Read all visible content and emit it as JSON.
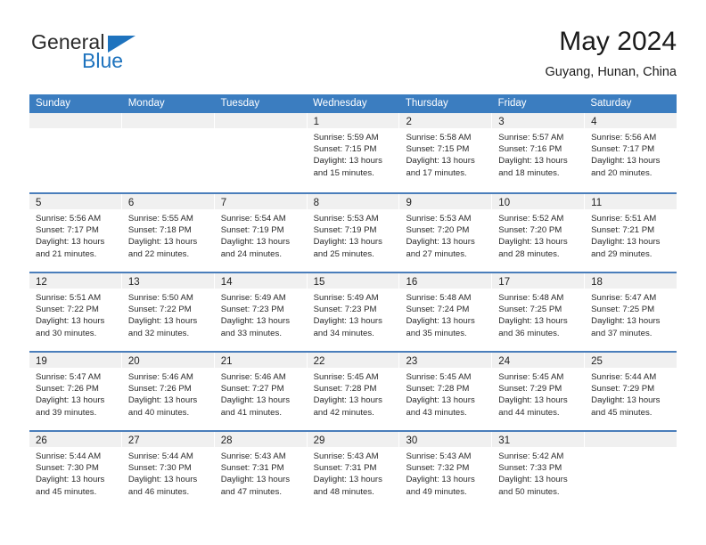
{
  "brand": {
    "name_top": "General",
    "name_bottom": "Blue",
    "triangle_color": "#1e73be"
  },
  "header": {
    "title": "May 2024",
    "subtitle": "Guyang, Hunan, China"
  },
  "theme": {
    "header_row_bg": "#3b7dc0",
    "week_separator": "#4a7ebb",
    "daynum_band_bg": "#f0f0f0",
    "text": "#222222"
  },
  "weekdays": [
    "Sunday",
    "Monday",
    "Tuesday",
    "Wednesday",
    "Thursday",
    "Friday",
    "Saturday"
  ],
  "weeks": [
    [
      {
        "day": "",
        "sunrise": "",
        "sunset": "",
        "daylight_1": "",
        "daylight_2": ""
      },
      {
        "day": "",
        "sunrise": "",
        "sunset": "",
        "daylight_1": "",
        "daylight_2": ""
      },
      {
        "day": "",
        "sunrise": "",
        "sunset": "",
        "daylight_1": "",
        "daylight_2": ""
      },
      {
        "day": "1",
        "sunrise": "Sunrise: 5:59 AM",
        "sunset": "Sunset: 7:15 PM",
        "daylight_1": "Daylight: 13 hours",
        "daylight_2": "and 15 minutes."
      },
      {
        "day": "2",
        "sunrise": "Sunrise: 5:58 AM",
        "sunset": "Sunset: 7:15 PM",
        "daylight_1": "Daylight: 13 hours",
        "daylight_2": "and 17 minutes."
      },
      {
        "day": "3",
        "sunrise": "Sunrise: 5:57 AM",
        "sunset": "Sunset: 7:16 PM",
        "daylight_1": "Daylight: 13 hours",
        "daylight_2": "and 18 minutes."
      },
      {
        "day": "4",
        "sunrise": "Sunrise: 5:56 AM",
        "sunset": "Sunset: 7:17 PM",
        "daylight_1": "Daylight: 13 hours",
        "daylight_2": "and 20 minutes."
      }
    ],
    [
      {
        "day": "5",
        "sunrise": "Sunrise: 5:56 AM",
        "sunset": "Sunset: 7:17 PM",
        "daylight_1": "Daylight: 13 hours",
        "daylight_2": "and 21 minutes."
      },
      {
        "day": "6",
        "sunrise": "Sunrise: 5:55 AM",
        "sunset": "Sunset: 7:18 PM",
        "daylight_1": "Daylight: 13 hours",
        "daylight_2": "and 22 minutes."
      },
      {
        "day": "7",
        "sunrise": "Sunrise: 5:54 AM",
        "sunset": "Sunset: 7:19 PM",
        "daylight_1": "Daylight: 13 hours",
        "daylight_2": "and 24 minutes."
      },
      {
        "day": "8",
        "sunrise": "Sunrise: 5:53 AM",
        "sunset": "Sunset: 7:19 PM",
        "daylight_1": "Daylight: 13 hours",
        "daylight_2": "and 25 minutes."
      },
      {
        "day": "9",
        "sunrise": "Sunrise: 5:53 AM",
        "sunset": "Sunset: 7:20 PM",
        "daylight_1": "Daylight: 13 hours",
        "daylight_2": "and 27 minutes."
      },
      {
        "day": "10",
        "sunrise": "Sunrise: 5:52 AM",
        "sunset": "Sunset: 7:20 PM",
        "daylight_1": "Daylight: 13 hours",
        "daylight_2": "and 28 minutes."
      },
      {
        "day": "11",
        "sunrise": "Sunrise: 5:51 AM",
        "sunset": "Sunset: 7:21 PM",
        "daylight_1": "Daylight: 13 hours",
        "daylight_2": "and 29 minutes."
      }
    ],
    [
      {
        "day": "12",
        "sunrise": "Sunrise: 5:51 AM",
        "sunset": "Sunset: 7:22 PM",
        "daylight_1": "Daylight: 13 hours",
        "daylight_2": "and 30 minutes."
      },
      {
        "day": "13",
        "sunrise": "Sunrise: 5:50 AM",
        "sunset": "Sunset: 7:22 PM",
        "daylight_1": "Daylight: 13 hours",
        "daylight_2": "and 32 minutes."
      },
      {
        "day": "14",
        "sunrise": "Sunrise: 5:49 AM",
        "sunset": "Sunset: 7:23 PM",
        "daylight_1": "Daylight: 13 hours",
        "daylight_2": "and 33 minutes."
      },
      {
        "day": "15",
        "sunrise": "Sunrise: 5:49 AM",
        "sunset": "Sunset: 7:23 PM",
        "daylight_1": "Daylight: 13 hours",
        "daylight_2": "and 34 minutes."
      },
      {
        "day": "16",
        "sunrise": "Sunrise: 5:48 AM",
        "sunset": "Sunset: 7:24 PM",
        "daylight_1": "Daylight: 13 hours",
        "daylight_2": "and 35 minutes."
      },
      {
        "day": "17",
        "sunrise": "Sunrise: 5:48 AM",
        "sunset": "Sunset: 7:25 PM",
        "daylight_1": "Daylight: 13 hours",
        "daylight_2": "and 36 minutes."
      },
      {
        "day": "18",
        "sunrise": "Sunrise: 5:47 AM",
        "sunset": "Sunset: 7:25 PM",
        "daylight_1": "Daylight: 13 hours",
        "daylight_2": "and 37 minutes."
      }
    ],
    [
      {
        "day": "19",
        "sunrise": "Sunrise: 5:47 AM",
        "sunset": "Sunset: 7:26 PM",
        "daylight_1": "Daylight: 13 hours",
        "daylight_2": "and 39 minutes."
      },
      {
        "day": "20",
        "sunrise": "Sunrise: 5:46 AM",
        "sunset": "Sunset: 7:26 PM",
        "daylight_1": "Daylight: 13 hours",
        "daylight_2": "and 40 minutes."
      },
      {
        "day": "21",
        "sunrise": "Sunrise: 5:46 AM",
        "sunset": "Sunset: 7:27 PM",
        "daylight_1": "Daylight: 13 hours",
        "daylight_2": "and 41 minutes."
      },
      {
        "day": "22",
        "sunrise": "Sunrise: 5:45 AM",
        "sunset": "Sunset: 7:28 PM",
        "daylight_1": "Daylight: 13 hours",
        "daylight_2": "and 42 minutes."
      },
      {
        "day": "23",
        "sunrise": "Sunrise: 5:45 AM",
        "sunset": "Sunset: 7:28 PM",
        "daylight_1": "Daylight: 13 hours",
        "daylight_2": "and 43 minutes."
      },
      {
        "day": "24",
        "sunrise": "Sunrise: 5:45 AM",
        "sunset": "Sunset: 7:29 PM",
        "daylight_1": "Daylight: 13 hours",
        "daylight_2": "and 44 minutes."
      },
      {
        "day": "25",
        "sunrise": "Sunrise: 5:44 AM",
        "sunset": "Sunset: 7:29 PM",
        "daylight_1": "Daylight: 13 hours",
        "daylight_2": "and 45 minutes."
      }
    ],
    [
      {
        "day": "26",
        "sunrise": "Sunrise: 5:44 AM",
        "sunset": "Sunset: 7:30 PM",
        "daylight_1": "Daylight: 13 hours",
        "daylight_2": "and 45 minutes."
      },
      {
        "day": "27",
        "sunrise": "Sunrise: 5:44 AM",
        "sunset": "Sunset: 7:30 PM",
        "daylight_1": "Daylight: 13 hours",
        "daylight_2": "and 46 minutes."
      },
      {
        "day": "28",
        "sunrise": "Sunrise: 5:43 AM",
        "sunset": "Sunset: 7:31 PM",
        "daylight_1": "Daylight: 13 hours",
        "daylight_2": "and 47 minutes."
      },
      {
        "day": "29",
        "sunrise": "Sunrise: 5:43 AM",
        "sunset": "Sunset: 7:31 PM",
        "daylight_1": "Daylight: 13 hours",
        "daylight_2": "and 48 minutes."
      },
      {
        "day": "30",
        "sunrise": "Sunrise: 5:43 AM",
        "sunset": "Sunset: 7:32 PM",
        "daylight_1": "Daylight: 13 hours",
        "daylight_2": "and 49 minutes."
      },
      {
        "day": "31",
        "sunrise": "Sunrise: 5:42 AM",
        "sunset": "Sunset: 7:33 PM",
        "daylight_1": "Daylight: 13 hours",
        "daylight_2": "and 50 minutes."
      },
      {
        "day": "",
        "sunrise": "",
        "sunset": "",
        "daylight_1": "",
        "daylight_2": ""
      }
    ]
  ]
}
